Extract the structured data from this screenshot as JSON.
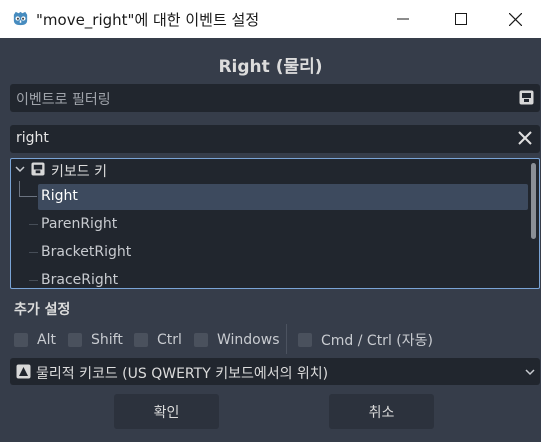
{
  "window": {
    "title": "\"move_right\"에 대한 이벤트 설정"
  },
  "dialog": {
    "heading": "Right (물리)",
    "filter": {
      "placeholder": "이벤트로 필터링",
      "icon": "keyboard-icon"
    },
    "search": {
      "value": "right",
      "clear_icon": "close-icon"
    },
    "tree": {
      "root_label": "키보드 키",
      "items": [
        {
          "label": "Right",
          "selected": true
        },
        {
          "label": "ParenRight",
          "selected": false
        },
        {
          "label": "BracketRight",
          "selected": false
        },
        {
          "label": "BraceRight",
          "selected": false
        }
      ]
    },
    "additional_settings": {
      "label": "추가 설정",
      "modifiers": [
        "Alt",
        "Shift",
        "Ctrl",
        "Windows",
        "Cmd / Ctrl (자동)"
      ]
    },
    "location_select": {
      "selected": "물리적 키코드 (US QWERTY 키보드에서의 위치)"
    },
    "buttons": {
      "ok": "확인",
      "cancel": "취소"
    }
  },
  "colors": {
    "background": "#363d4a",
    "field": "#21262e",
    "selection": "#3d4a5e",
    "focus_border": "#7aa4d6",
    "godot_blue": "#478cbf"
  }
}
